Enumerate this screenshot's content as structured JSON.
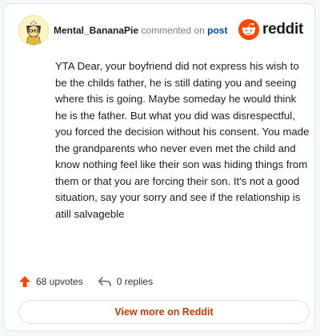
{
  "header": {
    "username": "Mental_BananaPie",
    "action_text": "commented on",
    "post_link": "post",
    "brand": "reddit"
  },
  "comment": {
    "body": "YTA Dear, your boyfriend did not express his wish to be the childs father, he is still dating you and seeing where this is going. Maybe someday he would think he is the father. But what you did was disrespectful, you forced the decision without his consent. You made the grandparents who never even met the child and know nothing feel like their son was hiding things from them or that you are forcing their son. It's not a good situation, say your sorry and see if the relationship is atill salvageble"
  },
  "footer": {
    "upvotes": "68 upvotes",
    "replies": "0 replies"
  },
  "cta": {
    "label": "View more on Reddit"
  },
  "icons": {
    "avatar": "user-avatar",
    "brand": "reddit-logo-icon",
    "upvote": "upvote-arrow-icon",
    "reply": "reply-arrow-icon"
  },
  "colors": {
    "brand_orange": "#ff4500",
    "cta_text": "#c23a00",
    "post_link": "#0045ac"
  }
}
